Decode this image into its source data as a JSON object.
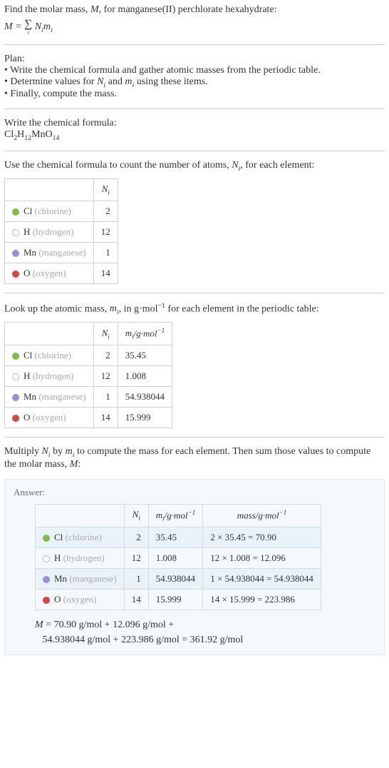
{
  "intro": {
    "line1": "Find the molar mass, M, for manganese(II) perchlorate hexahydrate:",
    "eq_left": "M = ",
    "sigma_idx": "i",
    "eq_right": " NᵢMᵢ"
  },
  "plan": {
    "heading": "Plan:",
    "b1": "• Write the chemical formula and gather atomic masses from the periodic table.",
    "b2_pre": "• Determine values for ",
    "b2_Ni": "Nᵢ",
    "b2_mid": " and ",
    "b2_mi": "mᵢ",
    "b2_post": " using these items.",
    "b3": "• Finally, compute the mass."
  },
  "write_formula": {
    "heading": "Write the chemical formula:",
    "formula_html": "Cl₂H₁₂MnO₁₄"
  },
  "count_atoms": {
    "heading_pre": "Use the chemical formula to count the number of atoms, ",
    "Ni": "Nᵢ",
    "heading_post": ", for each element:",
    "col_Ni": "Nᵢ",
    "elements": [
      {
        "dot": "#7fbf3f",
        "sym": "Cl",
        "name": "(chlorine)",
        "N": "2"
      },
      {
        "dot": "#ffffff",
        "border": "#bbb",
        "sym": "H",
        "name": "(hydrogen)",
        "N": "12"
      },
      {
        "dot": "#9b8fd9",
        "sym": "Mn",
        "name": "(manganese)",
        "N": "1"
      },
      {
        "dot": "#d94545",
        "sym": "O",
        "name": "(oxygen)",
        "N": "14"
      }
    ]
  },
  "atomic_mass": {
    "heading_pre": "Look up the atomic mass, ",
    "mi": "mᵢ",
    "heading_mid": ", in g·mol",
    "heading_exp": "−1",
    "heading_post": " for each element in the periodic table:",
    "col_Ni": "Nᵢ",
    "col_mi_pre": "mᵢ/g·mol",
    "col_mi_exp": "−1",
    "rows": [
      {
        "dot": "#7fbf3f",
        "sym": "Cl",
        "name": "(chlorine)",
        "N": "2",
        "m": "35.45"
      },
      {
        "dot": "#ffffff",
        "border": "#bbb",
        "sym": "H",
        "name": "(hydrogen)",
        "N": "12",
        "m": "1.008"
      },
      {
        "dot": "#9b8fd9",
        "sym": "Mn",
        "name": "(manganese)",
        "N": "1",
        "m": "54.938044"
      },
      {
        "dot": "#d94545",
        "sym": "O",
        "name": "(oxygen)",
        "N": "14",
        "m": "15.999"
      }
    ]
  },
  "multiply": {
    "text_pre": "Multiply ",
    "Ni": "Nᵢ",
    "text_mid1": " by ",
    "mi": "mᵢ",
    "text_mid2": " to compute the mass for each element. Then sum those values to compute the molar mass, ",
    "M": "M",
    "text_post": ":"
  },
  "answer": {
    "label": "Answer:",
    "col_Ni": "Nᵢ",
    "col_mi_pre": "mᵢ/g·mol",
    "col_mi_exp": "−1",
    "col_mass_pre": "mass/g·mol",
    "col_mass_exp": "−1",
    "rows": [
      {
        "dot": "#7fbf3f",
        "sym": "Cl",
        "name": "(chlorine)",
        "N": "2",
        "m": "35.45",
        "calc": "2 × 35.45 = 70.90"
      },
      {
        "dot": "#ffffff",
        "border": "#bbb",
        "sym": "H",
        "name": "(hydrogen)",
        "N": "12",
        "m": "1.008",
        "calc": "12 × 1.008 = 12.096"
      },
      {
        "dot": "#9b8fd9",
        "sym": "Mn",
        "name": "(manganese)",
        "N": "1",
        "m": "54.938044",
        "calc": "1 × 54.938044 = 54.938044"
      },
      {
        "dot": "#d94545",
        "sym": "O",
        "name": "(oxygen)",
        "N": "14",
        "m": "15.999",
        "calc": "14 × 15.999 = 223.986"
      }
    ],
    "final_line1_pre": "M",
    "final_line1": " = 70.90 g/mol + 12.096 g/mol + ",
    "final_line2": "54.938044 g/mol + 223.986 g/mol = 361.92 g/mol"
  }
}
